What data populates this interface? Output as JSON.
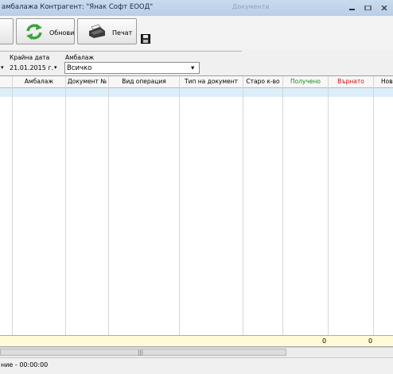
{
  "window": {
    "title": "амбалажа Контрагент: \"Янак Софт ЕООД\"",
    "ghost_title": "Документи"
  },
  "toolbar": {
    "refresh_label": "Обнови",
    "print_label": "Печат"
  },
  "filters": {
    "end_date_label": "Крайна дата",
    "end_date_value": "21.01.2015 г.",
    "packaging_label": "Амбалаж",
    "packaging_value": "Всичко"
  },
  "grid": {
    "columns": [
      "Амбалаж",
      "Документ №",
      "Вид операция",
      "Тип на документ",
      "Старо к-во",
      "Получено",
      "Върнато",
      "Нов"
    ],
    "colors": {
      "received": "#1a8a1a",
      "returned": "#d01010"
    }
  },
  "totals": {
    "received": "0",
    "returned": "0"
  },
  "status": {
    "text": "ние - 00:00:00"
  }
}
